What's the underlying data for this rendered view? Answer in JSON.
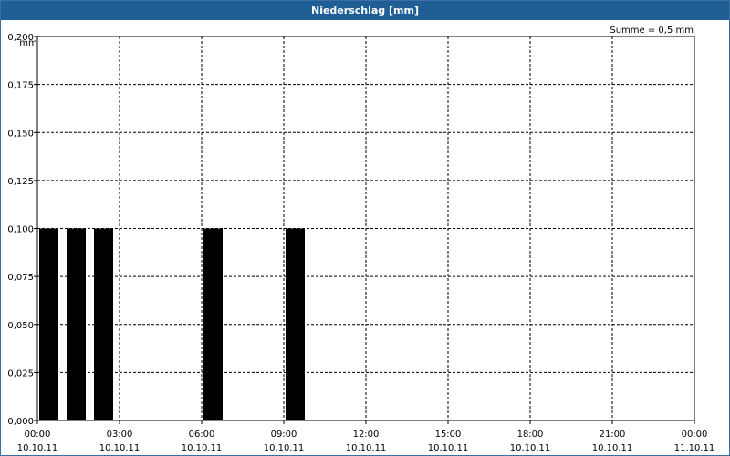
{
  "window": {
    "title": "Niederschlag [mm]"
  },
  "summary": "Summe = 0,5 mm",
  "chart_data": {
    "type": "bar",
    "title": "Niederschlag [mm]",
    "ylabel": "mm",
    "ylim": [
      0,
      0.2
    ],
    "grid": true,
    "y_ticks": [
      "0,000",
      "0,025",
      "0,050",
      "0,075",
      "0,100",
      "0,125",
      "0,150",
      "0,175",
      "0,200"
    ],
    "x_ticks": [
      {
        "time": "00:00",
        "date": "10.10.11"
      },
      {
        "time": "03:00",
        "date": "10.10.11"
      },
      {
        "time": "06:00",
        "date": "10.10.11"
      },
      {
        "time": "09:00",
        "date": "10.10.11"
      },
      {
        "time": "12:00",
        "date": "10.10.11"
      },
      {
        "time": "15:00",
        "date": "10.10.11"
      },
      {
        "time": "18:00",
        "date": "10.10.11"
      },
      {
        "time": "21:00",
        "date": "10.10.11"
      },
      {
        "time": "00:00",
        "date": "11.10.11"
      }
    ],
    "x_range": [
      "10.10.11 00:00",
      "11.10.11 00:00"
    ],
    "bars": [
      {
        "start": "10.10.11 00:00",
        "end": "10.10.11 01:00",
        "value": 0.1
      },
      {
        "start": "10.10.11 01:00",
        "end": "10.10.11 02:00",
        "value": 0.1
      },
      {
        "start": "10.10.11 02:00",
        "end": "10.10.11 03:00",
        "value": 0.1
      },
      {
        "start": "10.10.11 06:00",
        "end": "10.10.11 07:00",
        "value": 0.1
      },
      {
        "start": "10.10.11 09:00",
        "end": "10.10.11 10:00",
        "value": 0.1
      }
    ],
    "colors": {
      "bar": "#000000",
      "titlebar": "#1f5f96"
    }
  }
}
